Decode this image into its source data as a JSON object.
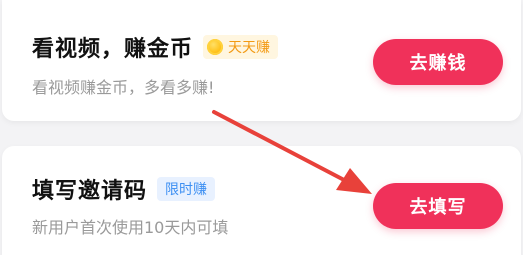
{
  "tasks": [
    {
      "title": "看视频，赚金币",
      "badge": "天天赚",
      "badge_icon": "gold-coin-icon",
      "subtitle": "看视频赚金币，多看多赚!",
      "button": "去赚钱"
    },
    {
      "title": "填写邀请码",
      "badge": "限时赚",
      "subtitle": "新用户首次使用10天内可填",
      "button": "去填写"
    }
  ],
  "colors": {
    "accent": "#f0315a",
    "arrow": "#e8413a",
    "gold_badge_text": "#f39a14",
    "blue_badge_text": "#3d8ff2"
  },
  "annotation": {
    "type": "arrow",
    "points_to": "fill-invite-code-button"
  }
}
